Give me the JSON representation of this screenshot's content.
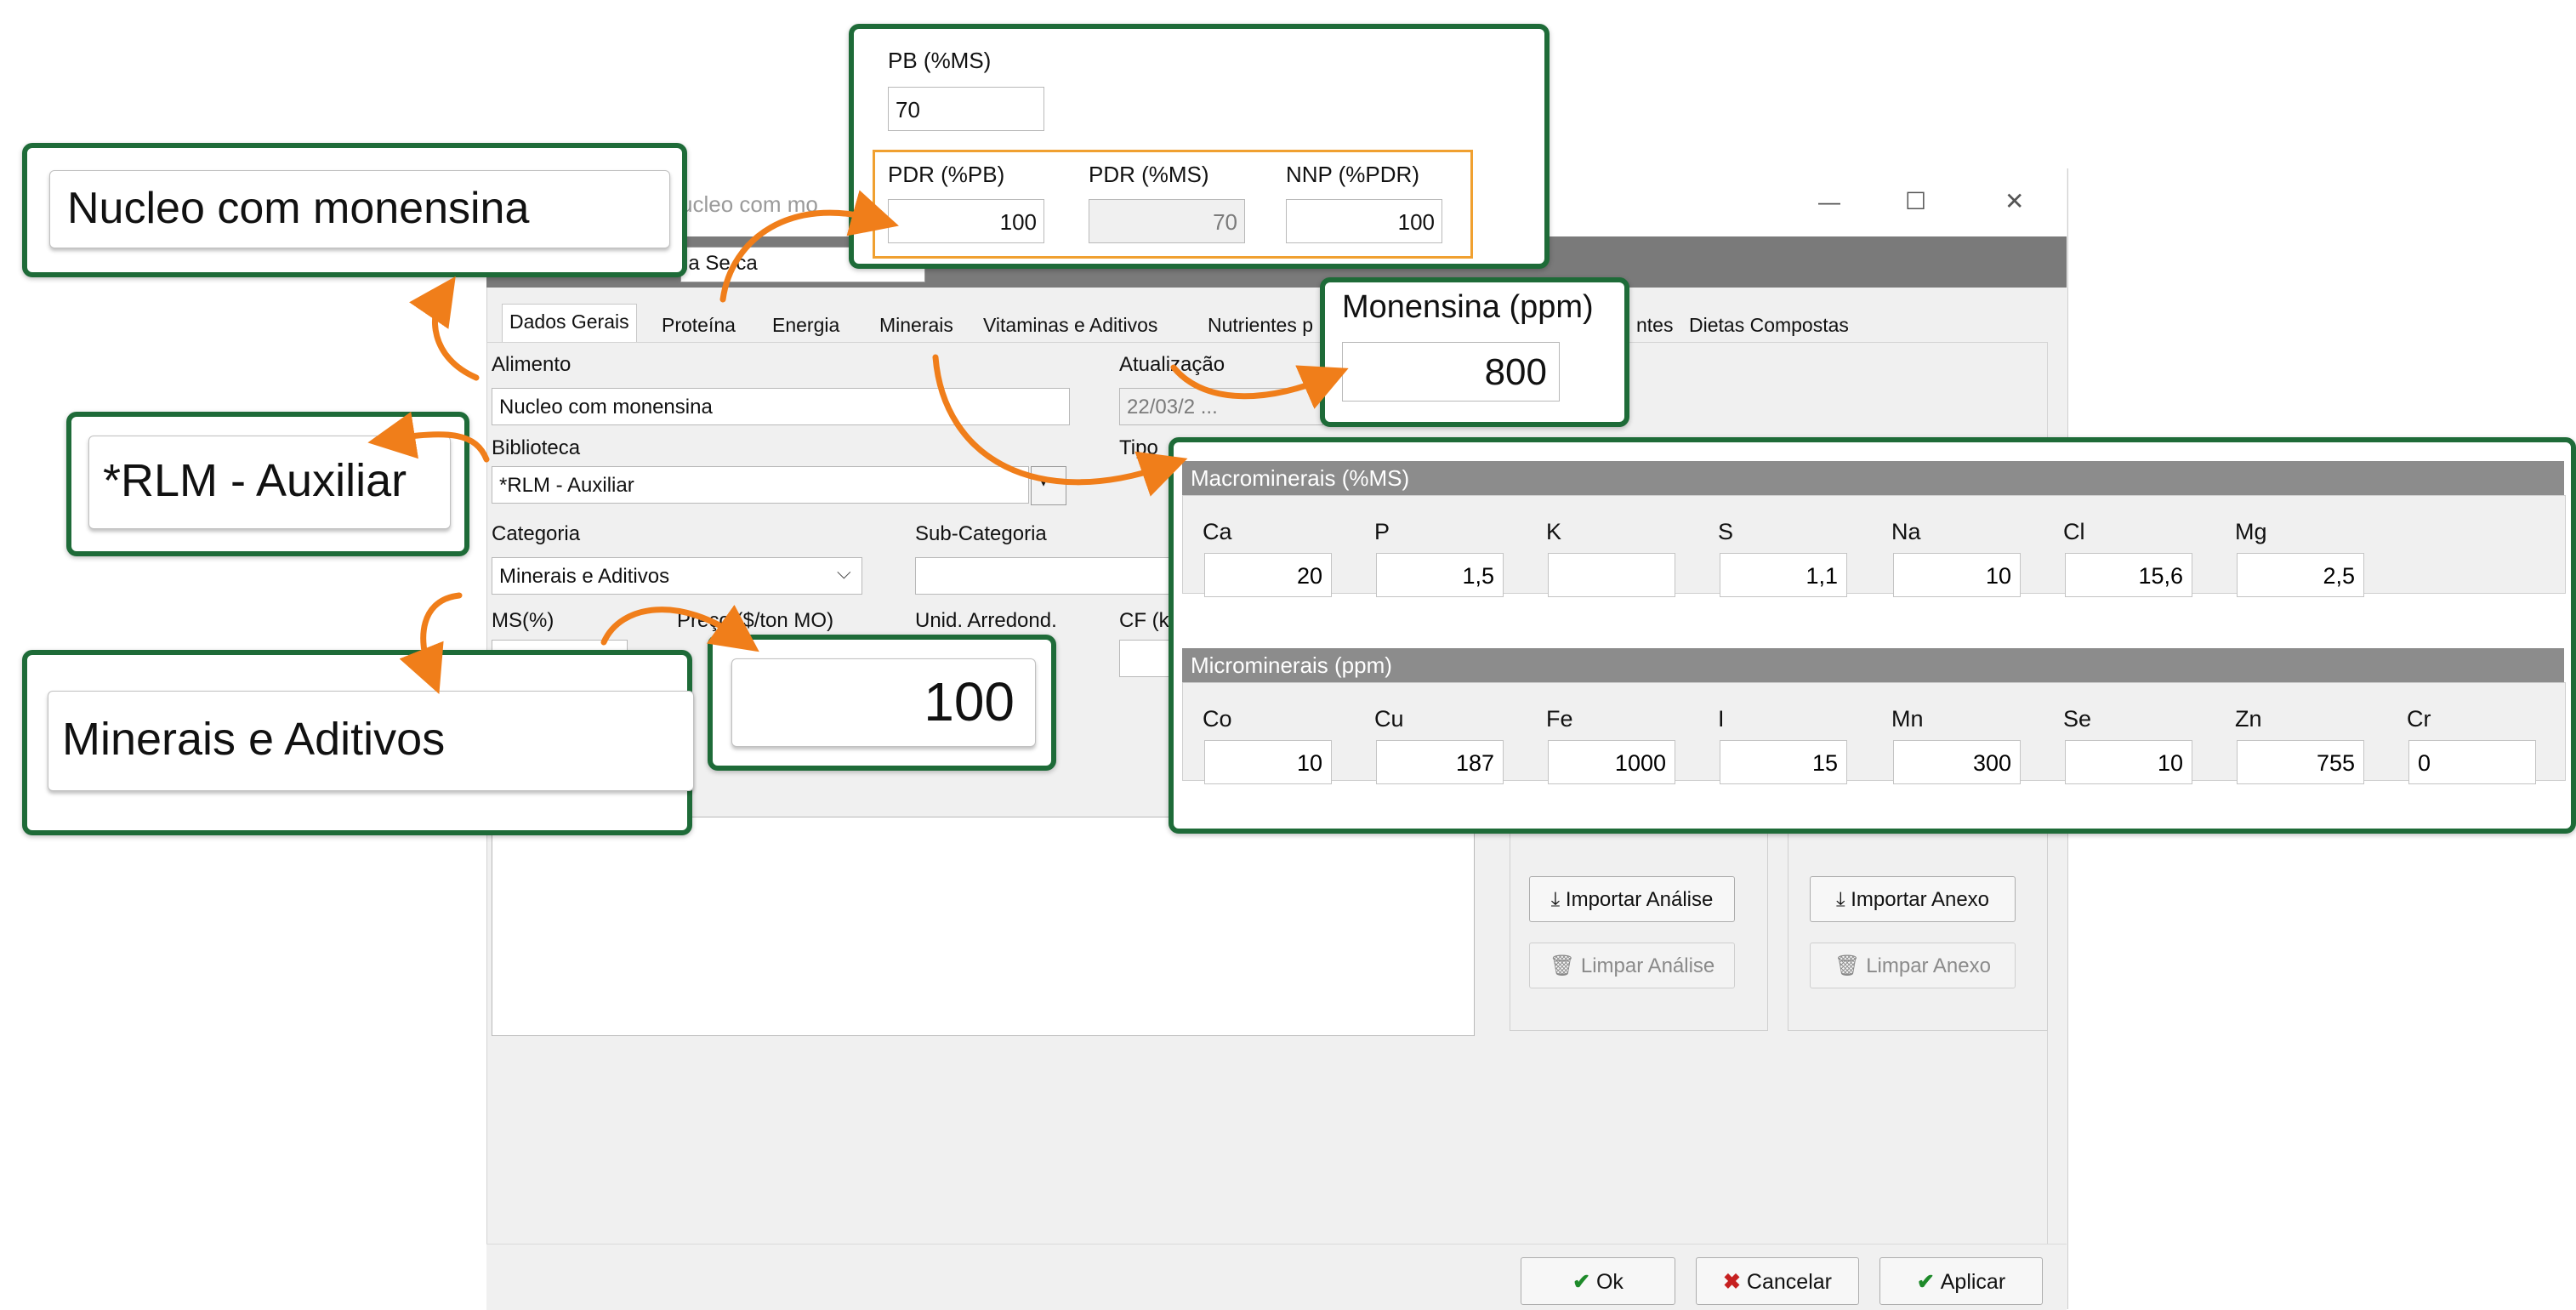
{
  "window": {
    "title_fragment": "ucleo com mo",
    "minimize": "—",
    "maximize": "☐",
    "close": "✕",
    "subtitle_fragment": "ia Se ca"
  },
  "tabs": [
    "Dados Gerais",
    "Proteína",
    "Energia",
    "Minerais",
    "Vitaminas e Aditivos",
    "Nutrientes p",
    "ntes",
    "Dietas Compostas"
  ],
  "form": {
    "alimento_label": "Alimento",
    "alimento_value": "Nucleo com monensina",
    "atualizacao_label": "Atualização",
    "atualizacao_value": "22/03/2 ...",
    "biblioteca_label": "Biblioteca",
    "biblioteca_value": "*RLM - Auxiliar",
    "tipo_label": "Tipo",
    "categoria_label": "Categoria",
    "categoria_value": "Minerais e Aditivos",
    "subcategoria_label": "Sub-Categoria",
    "ms_label": "MS(%)",
    "ms_value": "100",
    "preco_label": "Preço ($/ton MO)",
    "unid_label": "Unid. Arredond.",
    "cf_label": "CF (k"
  },
  "side_buttons": {
    "importar_analise": "Importar Análise",
    "limpar_analise": "Limpar Análise",
    "importar_anexo": "Importar Anexo",
    "limpar_anexo": "Limpar Anexo"
  },
  "footer_buttons": {
    "ok": "Ok",
    "cancelar": "Cancelar",
    "aplicar": "Aplicar"
  },
  "callouts": {
    "nucleo": "Nucleo com monensina",
    "rlm": "*RLM - Auxiliar",
    "minerais": "Minerais e Aditivos",
    "ms_big": "100",
    "monensina_label": "Monensina (ppm)",
    "monensina_value": "800",
    "protein": {
      "pb_label": "PB (%MS)",
      "pb_value": "70",
      "pdr_pb_label": "PDR (%PB)",
      "pdr_pb_value": "100",
      "pdr_ms_label": "PDR (%MS)",
      "pdr_ms_value": "70",
      "nnp_label": "NNP (%PDR)",
      "nnp_value": "100"
    },
    "macro": {
      "title": "Macrominerais (%MS)",
      "labels": [
        "Ca",
        "P",
        "K",
        "S",
        "Na",
        "Cl",
        "Mg"
      ],
      "values": [
        "20",
        "1,5",
        "",
        "1,1",
        "10",
        "15,6",
        "2,5"
      ]
    },
    "micro": {
      "title": "Microminerais (ppm)",
      "labels": [
        "Co",
        "Cu",
        "Fe",
        "I",
        "Mn",
        "Se",
        "Zn",
        "Cr"
      ],
      "values": [
        "10",
        "187",
        "1000",
        "15",
        "300",
        "10",
        "755",
        "0"
      ]
    }
  },
  "colors": {
    "callout_border": "#1e6b38",
    "arrow": "#f07e1a",
    "protein_inner_border": "#f0a030"
  }
}
